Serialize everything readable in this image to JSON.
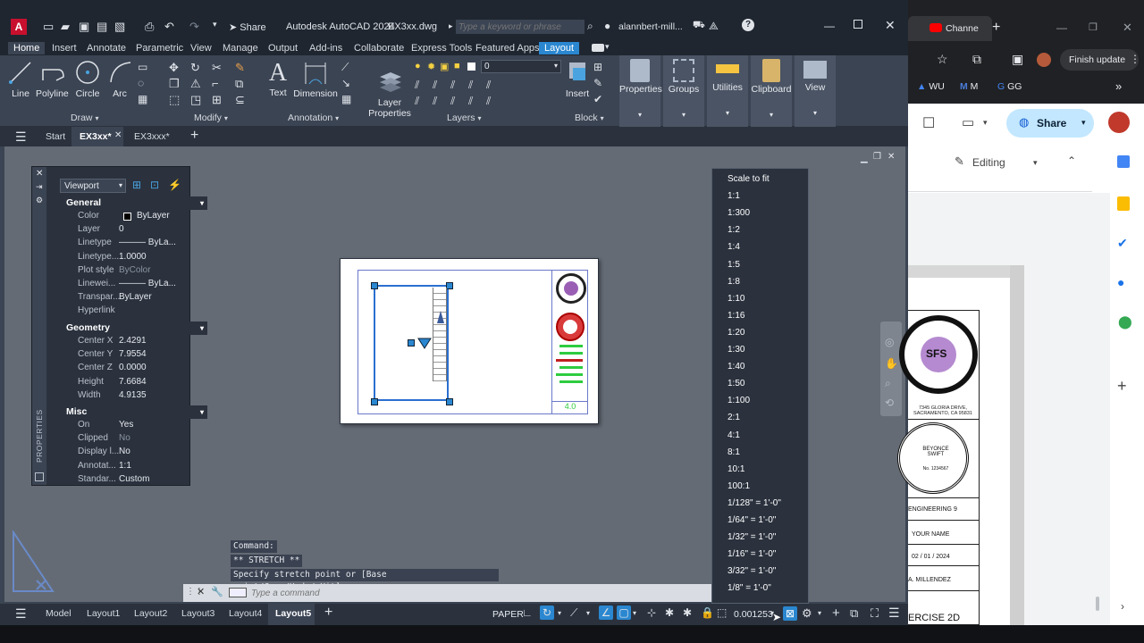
{
  "titlebar": {
    "app_badge": "A",
    "share_label": "Share",
    "app_title": "Autodesk AutoCAD 2024",
    "file_name": "EX3xx.dwg",
    "search_placeholder": "Type a keyword or phrase",
    "user": "alannbert-mill..."
  },
  "ribbon_tabs": [
    "Home",
    "Insert",
    "Annotate",
    "Parametric",
    "View",
    "Manage",
    "Output",
    "Add-ins",
    "Collaborate",
    "Express Tools",
    "Featured Apps",
    "Layout"
  ],
  "draw_tools": [
    "Line",
    "Polyline",
    "Circle",
    "Arc"
  ],
  "panels": {
    "draw": "Draw",
    "modify": "Modify",
    "annotation": "Annotation",
    "layers": "Layers",
    "block": "Block"
  },
  "annotation_tools": [
    "Text",
    "Dimension"
  ],
  "layer_properties": "Layer\nProperties",
  "layer_value": "0",
  "insert_label": "Insert",
  "big_buttons": [
    "Properties",
    "Groups",
    "Utilities",
    "Clipboard",
    "View"
  ],
  "doc_tabs": {
    "start": "Start",
    "active": "EX3xx*",
    "other": "EX3xxx*"
  },
  "properties": {
    "dropdown": "Viewport",
    "vertical_label": "PROPERTIES",
    "sections": {
      "general": "General",
      "geometry": "Geometry",
      "misc": "Misc"
    },
    "general": [
      {
        "k": "Color",
        "v": "ByLayer"
      },
      {
        "k": "Layer",
        "v": "0"
      },
      {
        "k": "Linetype",
        "v": "——— ByLa..."
      },
      {
        "k": "Linetype...",
        "v": "1.0000"
      },
      {
        "k": "Plot style",
        "v": "ByColor"
      },
      {
        "k": "Linewei...",
        "v": "——— ByLa..."
      },
      {
        "k": "Transpar...",
        "v": "ByLayer"
      },
      {
        "k": "Hyperlink",
        "v": ""
      }
    ],
    "geometry": [
      {
        "k": "Center X",
        "v": "2.4291"
      },
      {
        "k": "Center Y",
        "v": "7.9554"
      },
      {
        "k": "Center Z",
        "v": "0.0000"
      },
      {
        "k": "Height",
        "v": "7.6684"
      },
      {
        "k": "Width",
        "v": "4.9135"
      }
    ],
    "misc": [
      {
        "k": "On",
        "v": "Yes"
      },
      {
        "k": "Clipped",
        "v": "No"
      },
      {
        "k": "Display l...",
        "v": "No"
      },
      {
        "k": "Annotat...",
        "v": "1:1"
      },
      {
        "k": "Standar...",
        "v": "Custom"
      }
    ]
  },
  "sheet_label": "4.0",
  "scale_menu": [
    "Scale to fit",
    "1:1",
    "1:300",
    "1:2",
    "1:4",
    "1:5",
    "1:8",
    "1:10",
    "1:16",
    "1:20",
    "1:30",
    "1:40",
    "1:50",
    "1:100",
    "2:1",
    "4:1",
    "8:1",
    "10:1",
    "100:1",
    "1/128\" = 1'-0\"",
    "1/64\" = 1'-0\"",
    "1/32\" = 1'-0\"",
    "1/16\" = 1'-0\"",
    "3/32\" = 1'-0\"",
    "1/8\" = 1'-0\""
  ],
  "command": {
    "line1": "Command:",
    "line2": "** STRETCH **",
    "line3": "Specify stretch point or [Base point/Copy/Undo/eXit]:",
    "placeholder": "Type a command"
  },
  "status": {
    "tabs": [
      "Model",
      "Layout1",
      "Layout2",
      "Layout3",
      "Layout4",
      "Layout5"
    ],
    "paper": "PAPER",
    "scale": "0.001253"
  },
  "chrome": {
    "tab_title": "Channe",
    "finish_update": "Finish update",
    "bookmarks": [
      "WU",
      "M",
      "GG"
    ],
    "share": "Share",
    "editing": "Editing",
    "doc": {
      "address": "7345 GLORIA DRIVE,\nSACRAMENTO, CA 95831",
      "stamp_name": "BEYONCE\nSWIFT",
      "stamp_no": "No. 1234567",
      "row1": "ENGINEERING 9",
      "row2": "YOUR NAME",
      "row3": "02 / 01 / 2024",
      "row4": "A. MILLENDEZ",
      "row5": "ERCISE 2D",
      "logo_text": "SFS"
    }
  }
}
